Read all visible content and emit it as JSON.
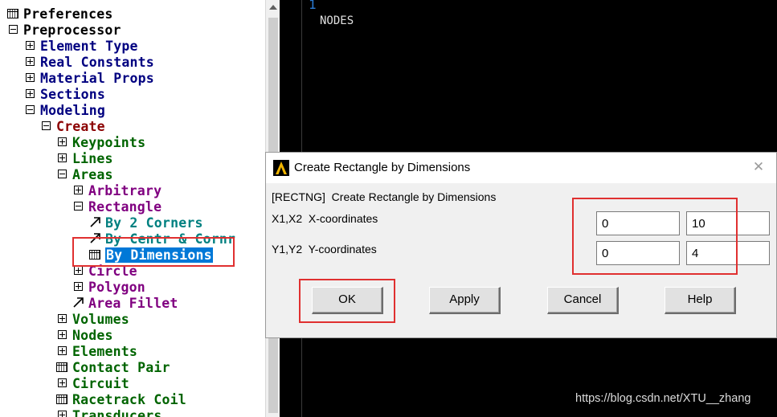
{
  "tree": {
    "rows": [
      {
        "label": "Preferences"
      },
      {
        "label": "Preprocessor"
      },
      {
        "label": "Element Type"
      },
      {
        "label": "Real Constants"
      },
      {
        "label": "Material Props"
      },
      {
        "label": "Sections"
      },
      {
        "label": "Modeling"
      },
      {
        "label": "Create"
      },
      {
        "label": "Keypoints"
      },
      {
        "label": "Lines"
      },
      {
        "label": "Areas"
      },
      {
        "label": "Arbitrary"
      },
      {
        "label": "Rectangle"
      },
      {
        "label": "By 2 Corners"
      },
      {
        "label": "By Centr & Cornr"
      },
      {
        "label": "By Dimensions"
      },
      {
        "label": "Circle"
      },
      {
        "label": "Polygon"
      },
      {
        "label": "Area Fillet"
      },
      {
        "label": "Volumes"
      },
      {
        "label": "Nodes"
      },
      {
        "label": "Elements"
      },
      {
        "label": "Contact Pair"
      },
      {
        "label": "Circuit"
      },
      {
        "label": "Racetrack Coil"
      },
      {
        "label": "Transducers"
      }
    ]
  },
  "graphics": {
    "window_number": "1",
    "nodes_label": "NODES",
    "watermark": "https://blog.csdn.net/XTU__zhang"
  },
  "dialog": {
    "title": "Create Rectangle by Dimensions",
    "close_glyph": "✕",
    "command": "[RECTNG]  Create Rectangle by Dimensions",
    "x_label": "X1,X2  X-coordinates",
    "y_label": "Y1,Y2  Y-coordinates",
    "x1": "0",
    "x2": "10",
    "y1": "0",
    "y2": "4",
    "ok": "OK",
    "apply": "Apply",
    "cancel": "Cancel",
    "help": "Help"
  },
  "colors": {
    "highlight": "#e03030",
    "selection": "#0078d7"
  }
}
